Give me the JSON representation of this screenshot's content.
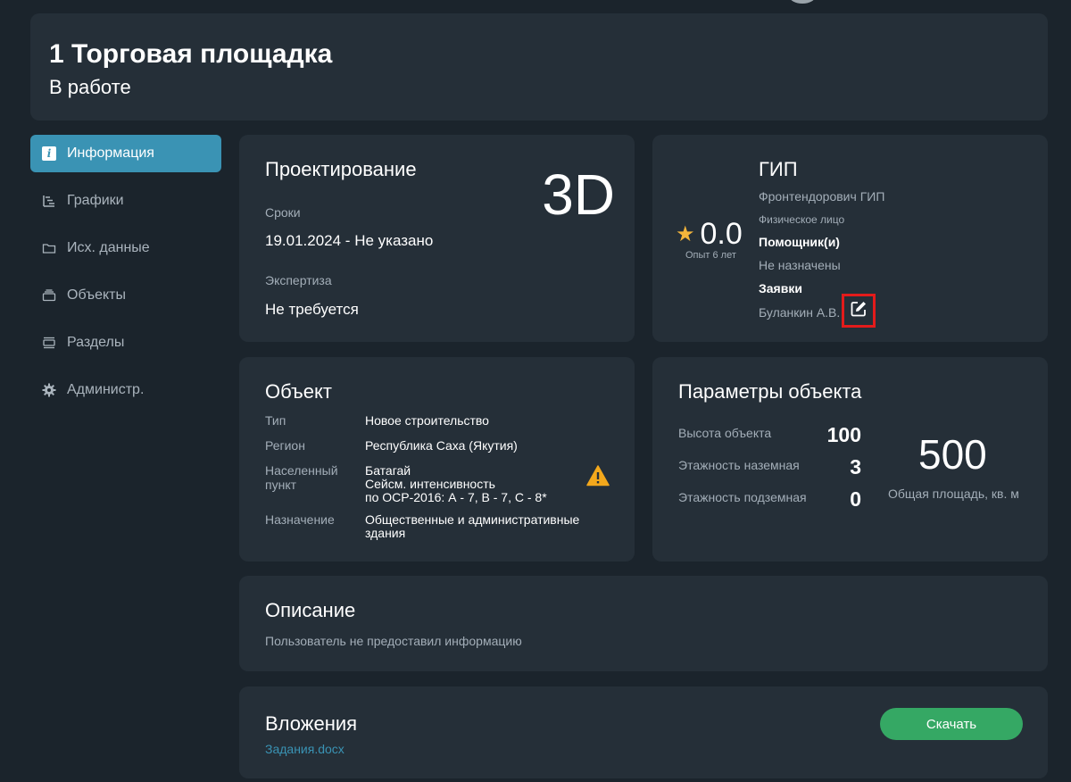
{
  "header": {
    "title": "1 Торговая площадка",
    "status": "В работе"
  },
  "sidebar": {
    "items": [
      {
        "label": "Информация",
        "icon": "info-icon",
        "active": true
      },
      {
        "label": "Графики",
        "icon": "gantt-icon"
      },
      {
        "label": "Исх. данные",
        "icon": "folder-icon"
      },
      {
        "label": "Объекты",
        "icon": "layers-icon"
      },
      {
        "label": "Разделы",
        "icon": "sections-icon"
      },
      {
        "label": "Администр.",
        "icon": "gear-icon"
      }
    ]
  },
  "project": {
    "title": "Проектирование",
    "badge": "3D",
    "deadline_label": "Сроки",
    "deadline_value": "19.01.2024 - Не указано",
    "expertise_label": "Экспертиза",
    "expertise_value": "Не требуется"
  },
  "gip": {
    "title": "ГИП",
    "name": "Фронтендорович ГИП",
    "person_type": "Физическое лицо",
    "assistants_label": "Помощник(и)",
    "assistants_value": "Не назначены",
    "requests_label": "Заявки",
    "requests_value": "Буланкин А.В.",
    "rating": "0.0",
    "experience": "Опыт 6 лет"
  },
  "object": {
    "title": "Объект",
    "type_label": "Тип",
    "type_value": "Новое строительство",
    "region_label": "Регион",
    "region_value": "Республика Саха (Якутия)",
    "settlement_label_1": "Населенный",
    "settlement_label_2": "пункт",
    "settlement_value": "Батагай",
    "seismic_line_1": "Сейсм. интенсивность",
    "seismic_line_2": "по ОСР-2016: А - 7, В - 7, С - 8*",
    "purpose_label": "Назначение",
    "purpose_line_1": "Общественные и административные",
    "purpose_line_2": "здания"
  },
  "params": {
    "title": "Параметры объекта",
    "height_label": "Высота объекта",
    "height_value": "100",
    "floors_above_label": "Этажность наземная",
    "floors_above_value": "3",
    "floors_below_label": "Этажность подземная",
    "floors_below_value": "0",
    "area_value": "500",
    "area_label": "Общая площадь, кв. м"
  },
  "description": {
    "title": "Описание",
    "text": "Пользователь не предоставил информацию"
  },
  "attachments": {
    "title": "Вложения",
    "file": "Задания.docx",
    "download_label": "Скачать"
  },
  "colors": {
    "background": "#1b242c",
    "card": "#252f38",
    "accent": "#3a93b4",
    "download": "#35a864",
    "warning": "#f3a81c",
    "star": "#f3b53b",
    "highlight": "#e31b1b"
  }
}
